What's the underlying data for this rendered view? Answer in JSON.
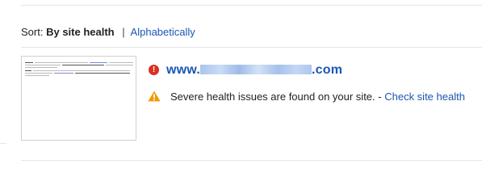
{
  "sort": {
    "label": "Sort:",
    "active_option": "By site health",
    "separator": "|",
    "alt_option": "Alphabetically"
  },
  "site": {
    "url_prefix": "www.",
    "url_suffix": ".com",
    "status_icon": "error-icon",
    "status_color": "#d93025"
  },
  "alert": {
    "icon": "warning-icon",
    "icon_color": "#f29900",
    "message": "Severe health issues are found on your site.",
    "dash": " - ",
    "action_link": "Check site health"
  },
  "colors": {
    "link": "#1a56b4",
    "text": "#222222"
  }
}
